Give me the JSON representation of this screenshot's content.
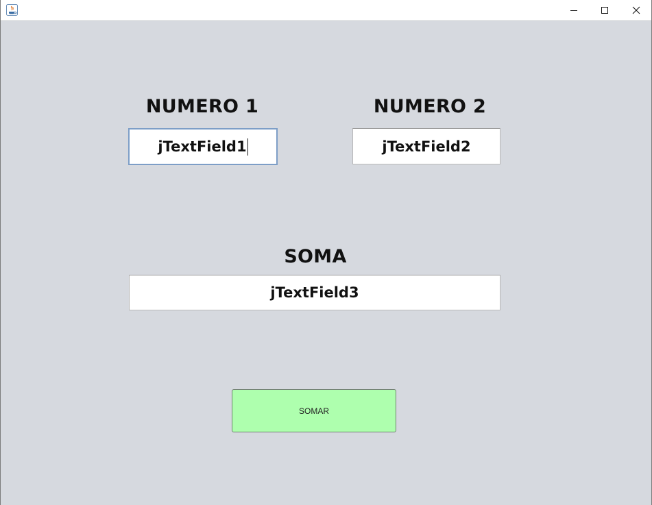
{
  "window": {
    "title": "",
    "controls": {
      "minimize_icon": "minimize-icon",
      "maximize_icon": "maximize-icon",
      "close_icon": "close-icon"
    }
  },
  "form": {
    "label1": "NUMERO 1",
    "label2": "NUMERO 2",
    "label3": "SOMA",
    "field1_value": "jTextField1",
    "field2_value": "jTextField2",
    "field3_value": "jTextField3",
    "button_label": "SOMAR"
  },
  "colors": {
    "background": "#d6d9df",
    "button": "#aeffae",
    "focus_border": "#7d9ec7"
  }
}
